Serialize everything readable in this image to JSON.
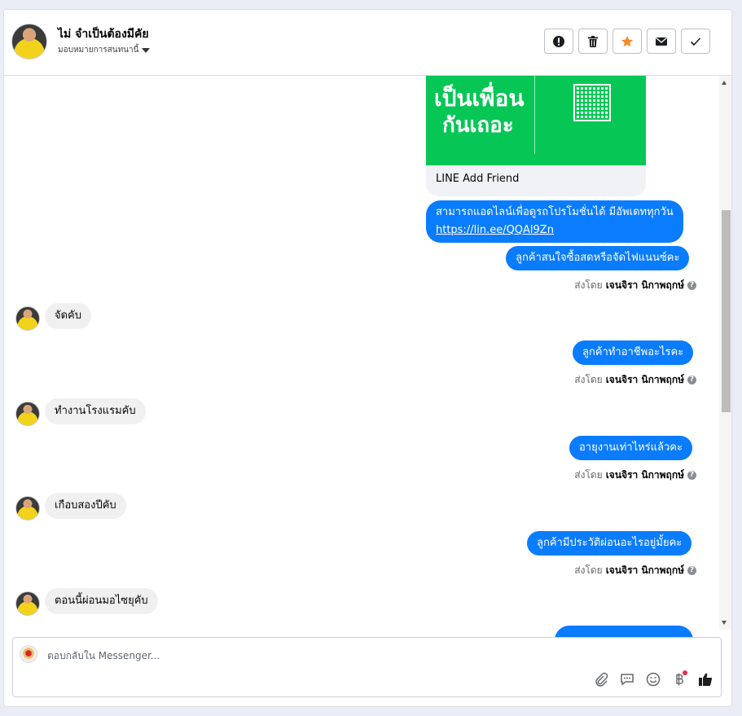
{
  "header": {
    "contact_name": "ไม่ จำเป็นต้องมีคัย",
    "assign_label": "มอบหมายการสนทนานี้",
    "actions": [
      {
        "name": "report-spam-button",
        "icon": "alert-icon"
      },
      {
        "name": "delete-button",
        "icon": "trash-icon"
      },
      {
        "name": "star-button",
        "icon": "star-icon"
      },
      {
        "name": "mark-unread-button",
        "icon": "envelope-icon"
      },
      {
        "name": "mark-done-button",
        "icon": "check-icon"
      }
    ]
  },
  "card": {
    "image_line1": "เป็นเพื่อน",
    "image_line2": "กันเถอะ",
    "title": "LINE Add Friend"
  },
  "messages": {
    "out1_text": "สามารถแอดไลน์เพื่อดูรถโปรโมชั่นได้ มีอัพเดททุกวัน",
    "out1_link": "https://lin.ee/QQAl9Zn",
    "out2": "ลูกค้าสนใจซื้อสดหรือจัดไฟแนนซ์คะ",
    "in1": "จัดคับ",
    "out3": "ลูกค้าทำอาชีพอะไรคะ",
    "in2": "ทำงานโรงแรมคับ",
    "out4": "อายุงานเท่าไหร่แล้วคะ",
    "in3": "เกือบสองปีคับ",
    "out5": "ลูกค้ามีประวัติผ่อนอะไรอยู่มั้ยคะ",
    "in4": "ตอนนี้ผ่อนมอไซยุคับ"
  },
  "sent_by": {
    "prefix": "ส่งโดย",
    "agent": "เจนจิรา นิกาพฤกษ์"
  },
  "composer": {
    "placeholder": "ตอบกลับใน Messenger..."
  },
  "colors": {
    "outgoing_bubble": "#0a7cff",
    "incoming_bubble": "#f0f0f0",
    "line_green": "#06c755"
  }
}
